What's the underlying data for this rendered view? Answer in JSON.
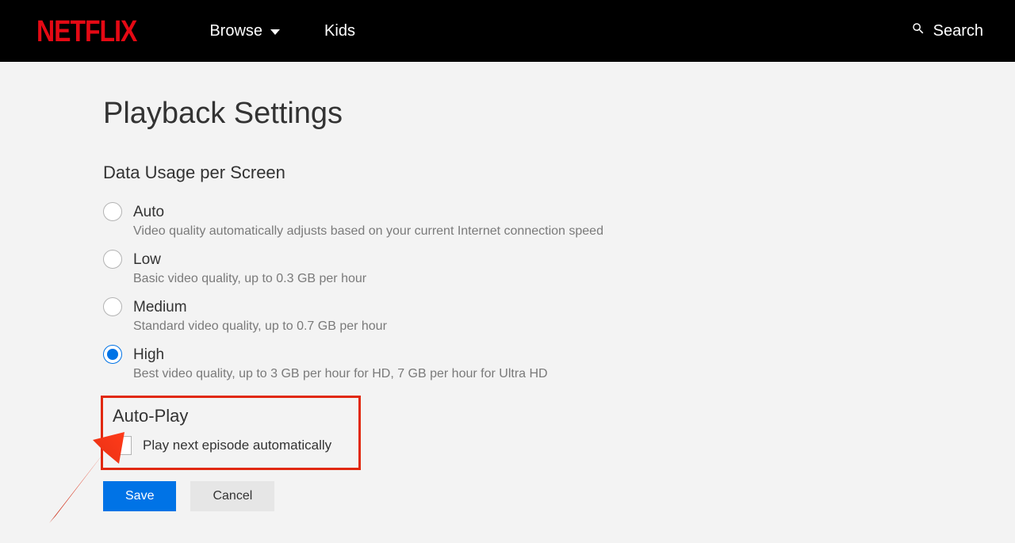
{
  "header": {
    "logo": "NETFLIX",
    "nav": {
      "browse": "Browse",
      "kids": "Kids"
    },
    "search": "Search"
  },
  "main": {
    "title": "Playback Settings",
    "data_usage": {
      "heading": "Data Usage per Screen",
      "options": [
        {
          "label": "Auto",
          "desc": "Video quality automatically adjusts based on your current Internet connection speed",
          "selected": false
        },
        {
          "label": "Low",
          "desc": "Basic video quality, up to 0.3 GB per hour",
          "selected": false
        },
        {
          "label": "Medium",
          "desc": "Standard video quality, up to 0.7 GB per hour",
          "selected": false
        },
        {
          "label": "High",
          "desc": "Best video quality, up to 3 GB per hour for HD, 7 GB per hour for Ultra HD",
          "selected": true
        }
      ]
    },
    "autoplay": {
      "heading": "Auto-Play",
      "checkbox_label": "Play next episode automatically",
      "checked": false
    },
    "buttons": {
      "save": "Save",
      "cancel": "Cancel"
    }
  }
}
